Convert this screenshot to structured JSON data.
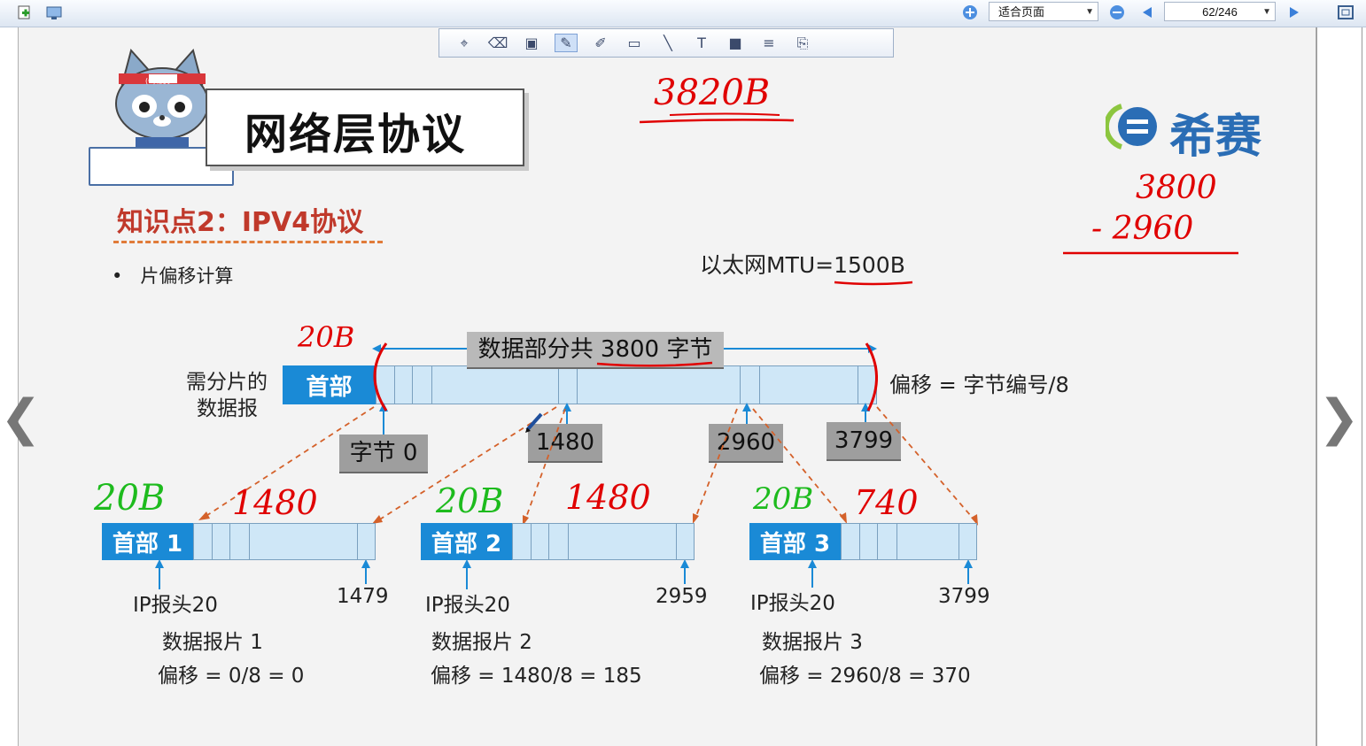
{
  "toolbar": {
    "zoom_mode": "适合页面",
    "page_indicator": "62/246"
  },
  "slide": {
    "title": "网络层协议",
    "mascot_badge": "(C)希赛",
    "brand": "希赛",
    "knowledge_point": "知识点2：IPV4协议",
    "bullet": "片偏移计算",
    "mtu": "以太网MTU=1500B",
    "datagram_label_line1": "需分片的",
    "datagram_label_line2": "数据报",
    "header_label": "首部",
    "data_total": "数据部分共 3800 字节",
    "offset_rule": "偏移 = 字节编号/8",
    "byte_labels": [
      "字节 0",
      "1480",
      "2960",
      "3799"
    ],
    "fragments": [
      {
        "header": "首部 1",
        "ip_head": "IP报头20",
        "end_byte": "1479",
        "name": "数据报片 1",
        "offset": "偏移 = 0/8 = 0"
      },
      {
        "header": "首部 2",
        "ip_head": "IP报头20",
        "end_byte": "2959",
        "name": "数据报片 2",
        "offset": "偏移 = 1480/8 = 185"
      },
      {
        "header": "首部 3",
        "ip_head": "IP报头20",
        "end_byte": "3799",
        "name": "数据报片 3",
        "offset": "偏移 = 2960/8 = 370"
      }
    ]
  },
  "annotations": {
    "total_size": "3820B",
    "calc_top": "3800",
    "calc_bottom": "- 2960",
    "header_size": "20B",
    "frag1_header": "20B",
    "frag1_data": "1480",
    "frag2_header": "20B",
    "frag2_data": "1480",
    "frag3_header": "20B",
    "frag3_data": "740"
  },
  "colors": {
    "header_blue": "#1a8ad6",
    "data_light_blue": "#cfe7f7",
    "knowledge_red": "#c0392b",
    "ink_red": "#e00000",
    "ink_green": "#1dbb1d",
    "brand_blue": "#2a6db5"
  }
}
